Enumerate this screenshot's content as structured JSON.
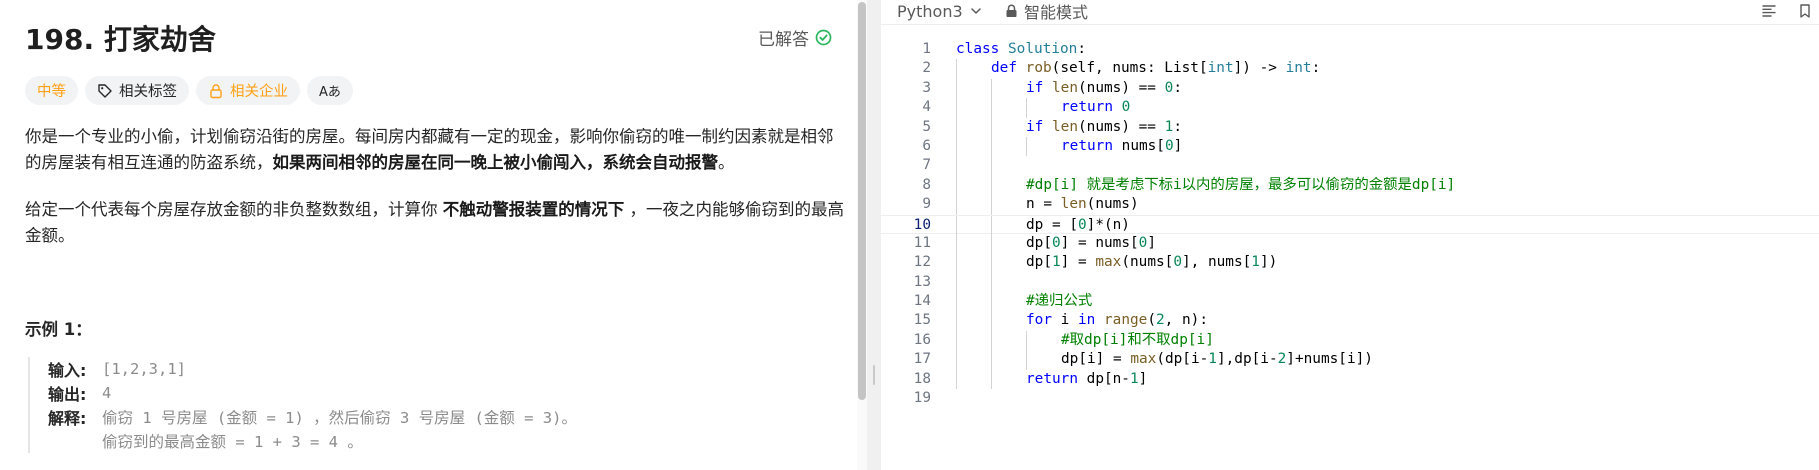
{
  "problem": {
    "title": "198. 打家劫舍",
    "status_label": "已解答",
    "tags": {
      "difficulty": "中等",
      "related_tags": "相关标签",
      "related_companies": "相关企业",
      "translate": "Aあ"
    },
    "p1_a": "你是一个专业的小偷，计划偷窃沿街的房屋。每间房内都藏有一定的现金，影响你偷窃的唯一制约因素就是相邻的房屋装有相互连通的防盗系统，",
    "p1_bold": "如果两间相邻的房屋在同一晚上被小偷闯入，系统会自动报警",
    "p1_end": "。",
    "p2_a": "给定一个代表每个房屋存放金额的非负整数数组，计算你 ",
    "p2_bold": "不触动警报装置的情况下",
    "p2_b": " ，一夜之内能够偷窃到的最高金额。",
    "example_title": "示例 1：",
    "example": {
      "input_label": "输入:",
      "input_value": "[1,2,3,1]",
      "output_label": "输出:",
      "output_value": "4",
      "explain_label": "解释:",
      "explain_line1": "偷窃 1 号房屋 (金额 = 1) ，然后偷窃 3 号房屋 (金额 = 3)。",
      "explain_line2": "偷窃到的最高金额 = 1 + 3 = 4 。"
    }
  },
  "editor": {
    "language": "Python3",
    "mode": "智能模式",
    "active_line": 10,
    "lines": [
      {
        "n": "1"
      },
      {
        "n": "2"
      },
      {
        "n": "3"
      },
      {
        "n": "4"
      },
      {
        "n": "5"
      },
      {
        "n": "6"
      },
      {
        "n": "7"
      },
      {
        "n": "8"
      },
      {
        "n": "9"
      },
      {
        "n": "10"
      },
      {
        "n": "11"
      },
      {
        "n": "12"
      },
      {
        "n": "13"
      },
      {
        "n": "14"
      },
      {
        "n": "15"
      },
      {
        "n": "16"
      },
      {
        "n": "17"
      },
      {
        "n": "18"
      },
      {
        "n": "19"
      }
    ],
    "tokens": {
      "class": "class",
      "Solution": "Solution",
      "def": "def",
      "rob": "rob",
      "self_nums": "(self, nums: List[",
      "int": "int",
      "sig_end": "]) -> ",
      "int2": "int",
      "colon": ":",
      "if": "if",
      "len": "len",
      "nums_eq": "(nums) == ",
      "zero": "0",
      "one": "1",
      "return": "return",
      "nums_idx": "nums[",
      "close": "]",
      "cm1": "#dp[i] 就是考虑下标i以内的房屋，最多可以偷窃的金额是dp[i]",
      "n_eq": "n = ",
      "len_nums": "(nums)",
      "dp_eq": "dp = [",
      "dp_mul": "]*(n)",
      "dp0": "dp[",
      "dp0_mid": "] = nums[",
      "dp1_mid": "] = ",
      "max": "max",
      "max_args_a": "(nums[",
      "max_args_b": "], nums[",
      "max_args_c": "])",
      "cm2": "#递归公式",
      "for": "for",
      "i": " i ",
      "in": "in",
      "range": "range",
      "range_args_a": "(",
      "two": "2",
      "range_args_b": ", n):",
      "cm3": "#取dp[i]和不取dp[i]",
      "dpi": "dp[i] = ",
      "max_b_a": "(dp[i-",
      "max_b_b": "],dp[i-",
      "max_b_c": "]+nums[i])",
      "ret_dp": "dp[n-",
      "ret_end": "]"
    }
  }
}
